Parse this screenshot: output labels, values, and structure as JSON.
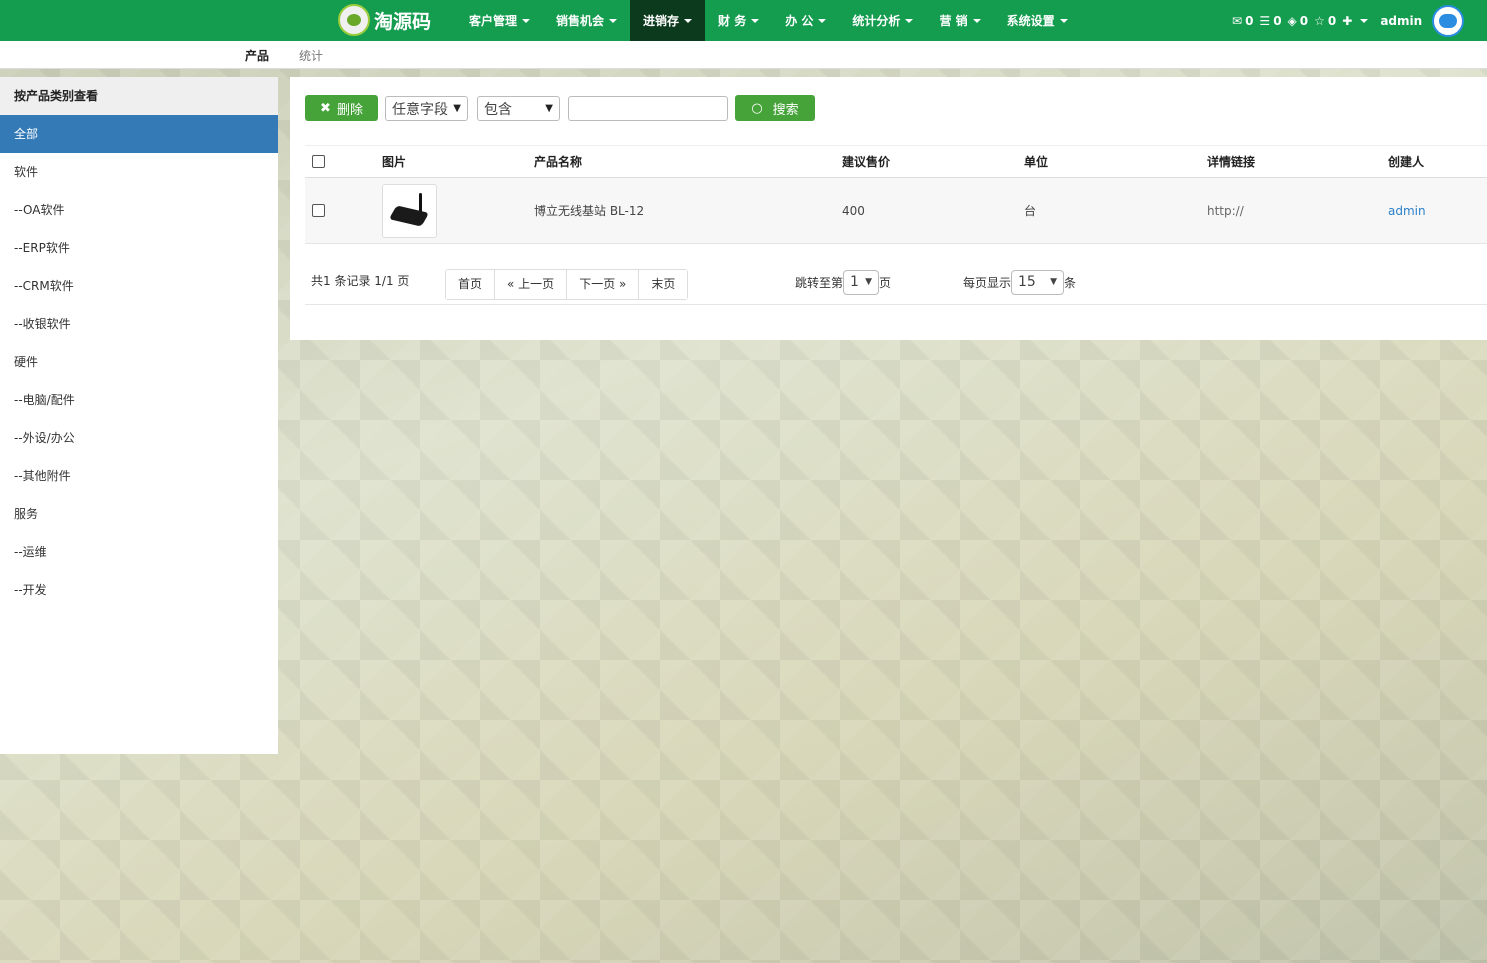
{
  "brand": {
    "name": "淘源码"
  },
  "nav": {
    "items": [
      {
        "label": "客户管理"
      },
      {
        "label": "销售机会"
      },
      {
        "label": "进销存"
      },
      {
        "label": "财 务"
      },
      {
        "label": "办 公"
      },
      {
        "label": "统计分析"
      },
      {
        "label": "营 销"
      },
      {
        "label": "系统设置"
      }
    ],
    "active_index": 2,
    "counters": {
      "mail": "0",
      "task": "0",
      "reminder": "0",
      "star": "0"
    },
    "user": "admin"
  },
  "subnav": {
    "product": "产品",
    "stats": "统计"
  },
  "sidebar": {
    "header": "按产品类别查看",
    "items": [
      {
        "label": "全部"
      },
      {
        "label": "软件"
      },
      {
        "label": "--OA软件"
      },
      {
        "label": "--ERP软件"
      },
      {
        "label": "--CRM软件"
      },
      {
        "label": "--收银软件"
      },
      {
        "label": "硬件"
      },
      {
        "label": "--电脑/配件"
      },
      {
        "label": "--外设/办公"
      },
      {
        "label": "--其他附件"
      },
      {
        "label": "服务"
      },
      {
        "label": "--运维"
      },
      {
        "label": "--开发"
      }
    ]
  },
  "toolbar": {
    "delete": "删除",
    "field_select": "任意字段",
    "op_select": "包含",
    "search_value": "",
    "search": "搜索"
  },
  "table": {
    "headers": {
      "image": "图片",
      "name": "产品名称",
      "price": "建议售价",
      "unit": "单位",
      "link": "详情链接",
      "creator": "创建人"
    },
    "rows": [
      {
        "name": "博立无线基站 BL-12",
        "price": "400",
        "unit": "台",
        "link": "http://",
        "creator": "admin"
      }
    ]
  },
  "pager": {
    "info": "共1 条记录 1/1 页",
    "first": "首页",
    "prev": "« 上一页",
    "next": "下一页 »",
    "last": "末页",
    "jump_prefix": "跳转至第",
    "jump_page": "1",
    "jump_suffix": "页",
    "per_page_prefix": "每页显示",
    "per_page": "15",
    "per_page_suffix": "条"
  }
}
